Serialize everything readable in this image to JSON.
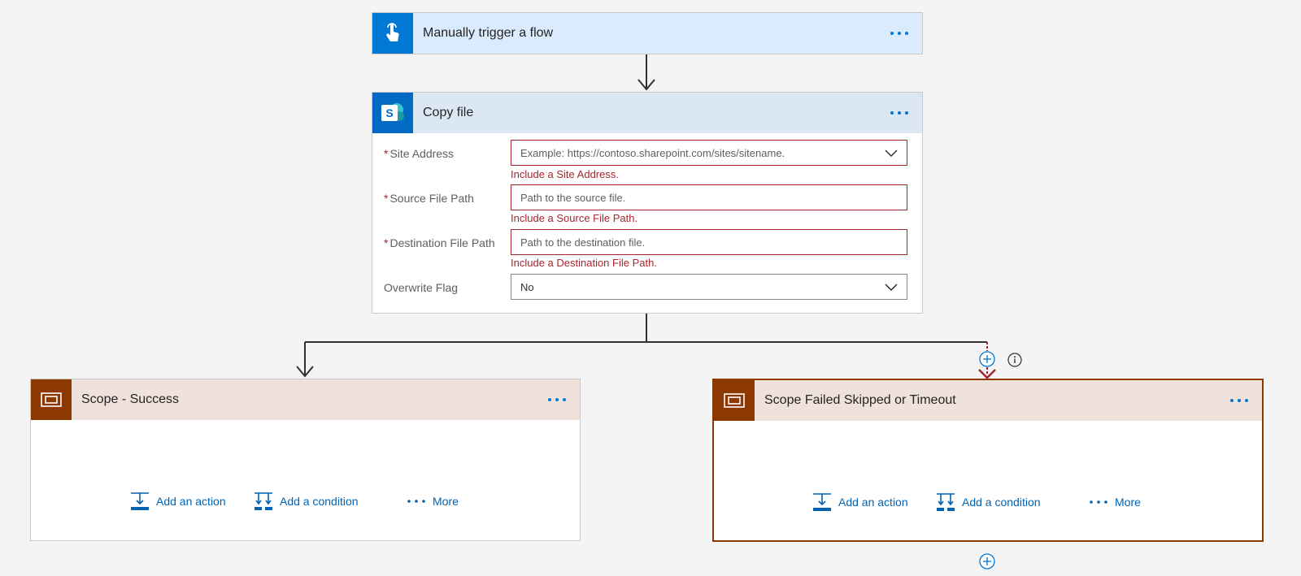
{
  "trigger": {
    "title": "Manually trigger a flow",
    "header_color": "#d9ebfd",
    "icon_bg": "#0078d4",
    "icon": "touch-hand-icon"
  },
  "copy_file": {
    "title": "Copy file",
    "header_color": "#dbe8f4",
    "icon_bg": "#036ac4",
    "icon_letter": "S",
    "icon": "sharepoint-icon",
    "fields": [
      {
        "label": "Site Address",
        "required": true,
        "required_mark": "*",
        "placeholder": "Example: https://contoso.sharepoint.com/sites/sitename.",
        "type": "dropdown",
        "error": "Include a Site Address."
      },
      {
        "label": "Source File Path",
        "required": true,
        "required_mark": "*",
        "placeholder": "Path to the source file.",
        "type": "text",
        "error": "Include a Source File Path."
      },
      {
        "label": "Destination File Path",
        "required": true,
        "required_mark": "*",
        "placeholder": "Path to the destination file.",
        "type": "text",
        "error": "Include a Destination File Path."
      },
      {
        "label": "Overwrite Flag",
        "required": false,
        "value": "No",
        "type": "dropdown"
      }
    ]
  },
  "scope_success": {
    "title": "Scope - Success",
    "header_color": "#efe2da",
    "icon_bg": "#8c3800",
    "icon": "scope-icon",
    "actions": {
      "add_action": "Add an action",
      "add_condition": "Add a condition",
      "more": "More"
    }
  },
  "scope_failed": {
    "title": "Scope Failed Skipped or Timeout",
    "header_color": "#efe2da",
    "icon_bg": "#8c3800",
    "icon": "scope-icon",
    "selected_border_color": "#8c3800",
    "actions": {
      "add_action": "Add an action",
      "add_condition": "Add a condition",
      "more": "More"
    }
  },
  "colors": {
    "accent": "#0078d4",
    "error": "#a4262c",
    "connector": "#323130",
    "run_after_connector": "#a4262c"
  }
}
